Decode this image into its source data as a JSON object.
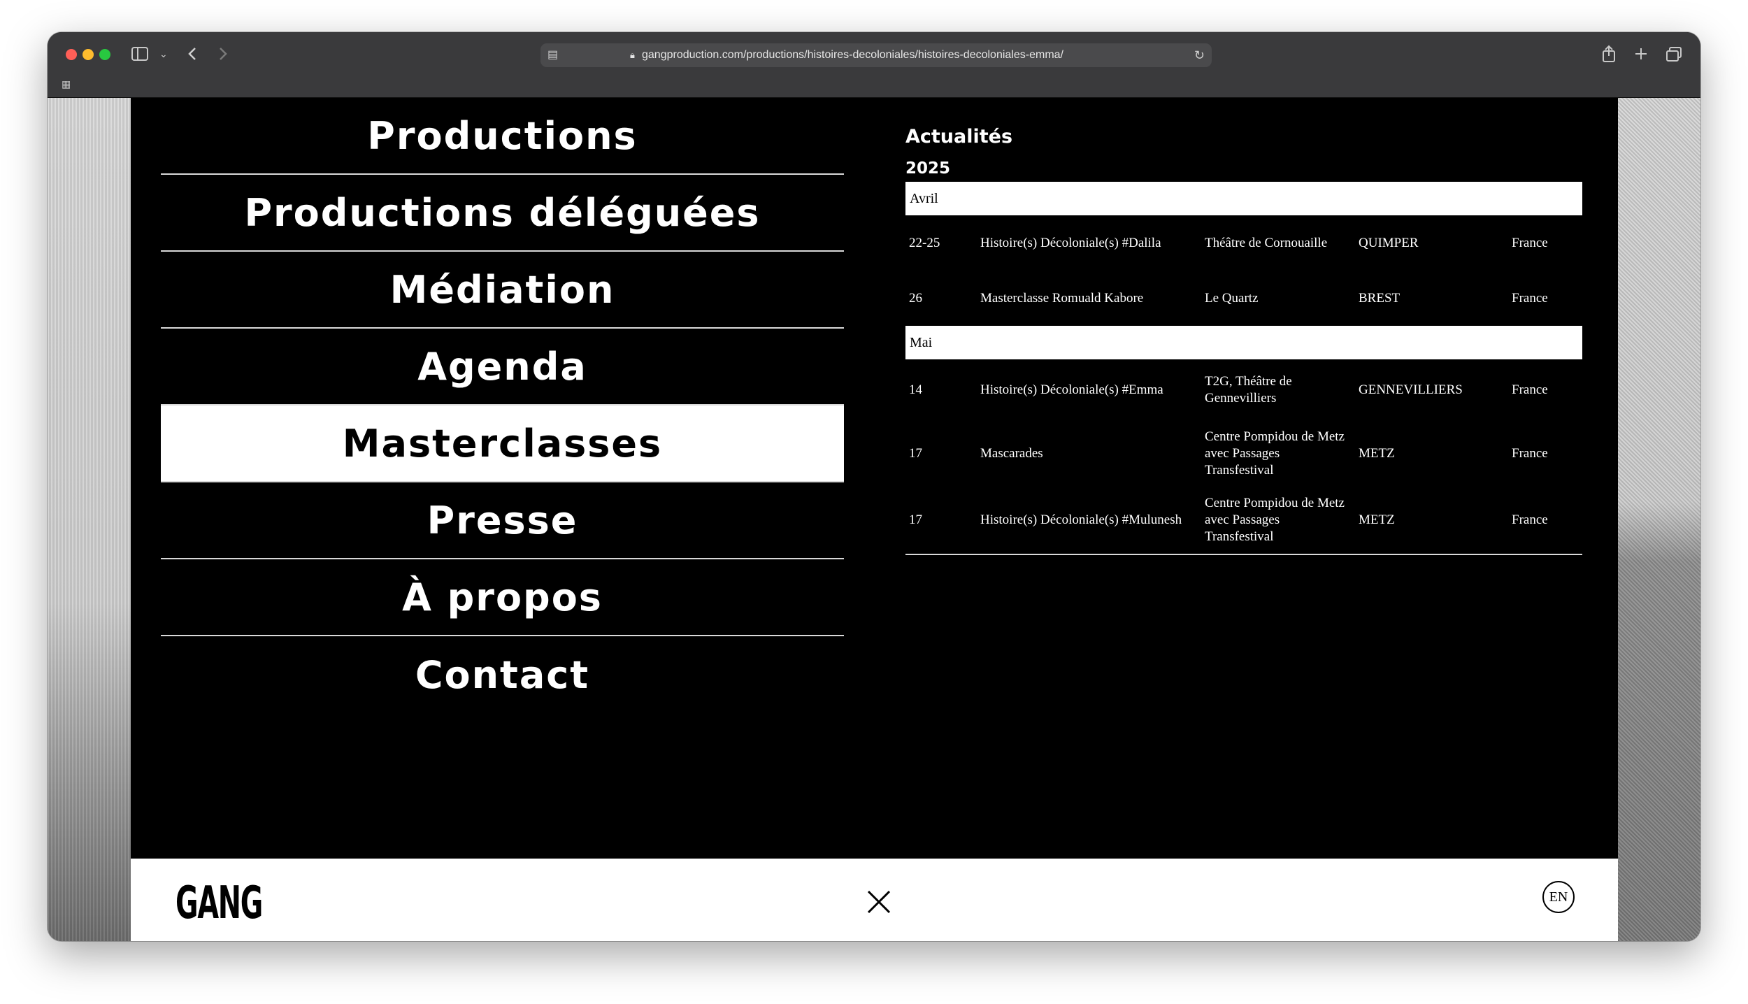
{
  "browser": {
    "url": "gangproduction.com/productions/histoires-decoloniales/histoires-decoloniales-emma/"
  },
  "menu": {
    "items": [
      {
        "label": "Productions"
      },
      {
        "label": "Productions déléguées"
      },
      {
        "label": "Médiation"
      },
      {
        "label": "Agenda"
      },
      {
        "label": "Masterclasses"
      },
      {
        "label": "Presse"
      },
      {
        "label": "À propos"
      },
      {
        "label": "Contact"
      }
    ],
    "active": "Masterclasses"
  },
  "news": {
    "title": "Actualités",
    "year": "2025",
    "months": [
      {
        "name": "Avril",
        "events": [
          {
            "date": "22-25",
            "title": "Histoire(s) Décoloniale(s) #Dalila",
            "venue": "Théâtre de Cornouaille",
            "city": "QUIMPER",
            "country": "France"
          },
          {
            "date": "26",
            "title": "Masterclasse Romuald Kabore",
            "venue": "Le Quartz",
            "city": "BREST",
            "country": "France"
          }
        ]
      },
      {
        "name": "Mai",
        "events": [
          {
            "date": "14",
            "title": "Histoire(s) Décoloniale(s) #Emma",
            "venue": "T2G, Théâtre de Gennevilliers",
            "city": "GENNEVILLIERS",
            "country": "France"
          },
          {
            "date": "17",
            "title": "Mascarades",
            "venue": "Centre Pompidou de Metz avec Passages Transfestival",
            "city": "METZ",
            "country": "France"
          },
          {
            "date": "17",
            "title": "Histoire(s) Décoloniale(s) #Mulunesh",
            "venue": "Centre Pompidou de Metz avec Passages Transfestival",
            "city": "METZ",
            "country": "France"
          }
        ]
      }
    ]
  },
  "footer": {
    "logo": "GANG",
    "lang": "EN"
  },
  "icons": {
    "close": "close-icon",
    "sidebar": "sidebar-icon",
    "back": "chevron-left-icon",
    "forward": "chevron-right-icon",
    "share": "share-icon",
    "new_tab": "plus-icon",
    "tabs": "tabs-overview-icon"
  }
}
